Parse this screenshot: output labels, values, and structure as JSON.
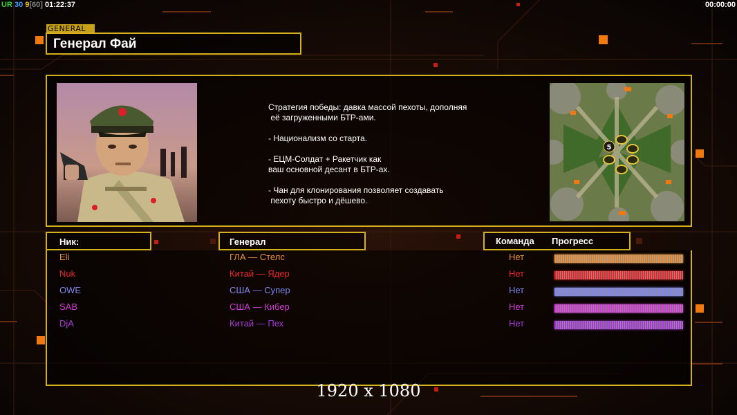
{
  "hud": {
    "left_prefix": "UR",
    "left_a": "30",
    "left_b": "9",
    "left_c": "[60]",
    "clock": "01:22:37",
    "right_clock": "00:00:00"
  },
  "header": {
    "tag": "GENERAL",
    "title": "Генерал Фай"
  },
  "info": {
    "strategy": "Стратегия победы: давка массой пехоты, дополняя\n её загруженными БТР-ами.\n\n- Национализм со старта.\n\n- ЕЦМ-Солдат + Ракетчик как\nваш основной десант в БТР-ах.\n\n- Чан для клонирования позволяет создавать\n пехоту быстро и дёшево.",
    "minimap_center_label": "5"
  },
  "columns": {
    "nick": "Ник:",
    "general": "Генерал",
    "team": "Команда",
    "progress": "Прогресс"
  },
  "players": [
    {
      "nick": "Eli",
      "general": "ГЛА — Стелс",
      "team": "Нет",
      "color": "#e8913a",
      "progress": 1.0
    },
    {
      "nick": "Nuk",
      "general": "Китай — Ядер",
      "team": "Нет",
      "color": "#e8262a",
      "progress": 1.0
    },
    {
      "nick": "OWE",
      "general": "США — Супер",
      "team": "Нет",
      "color": "#7f86f2",
      "progress": 1.0
    },
    {
      "nick": "SAB",
      "general": "США — Кибер",
      "team": "Нет",
      "color": "#d13ad4",
      "progress": 1.0
    },
    {
      "nick": "DjA",
      "general": "Китай — Пех",
      "team": "Нет",
      "color": "#a53ad6",
      "progress": 1.0
    }
  ],
  "footer": {
    "resolution": "1920 x 1080"
  },
  "colors": {
    "frame": "#d4b21d",
    "accent_orange": "#f07a10",
    "accent_red": "#d21c12"
  }
}
